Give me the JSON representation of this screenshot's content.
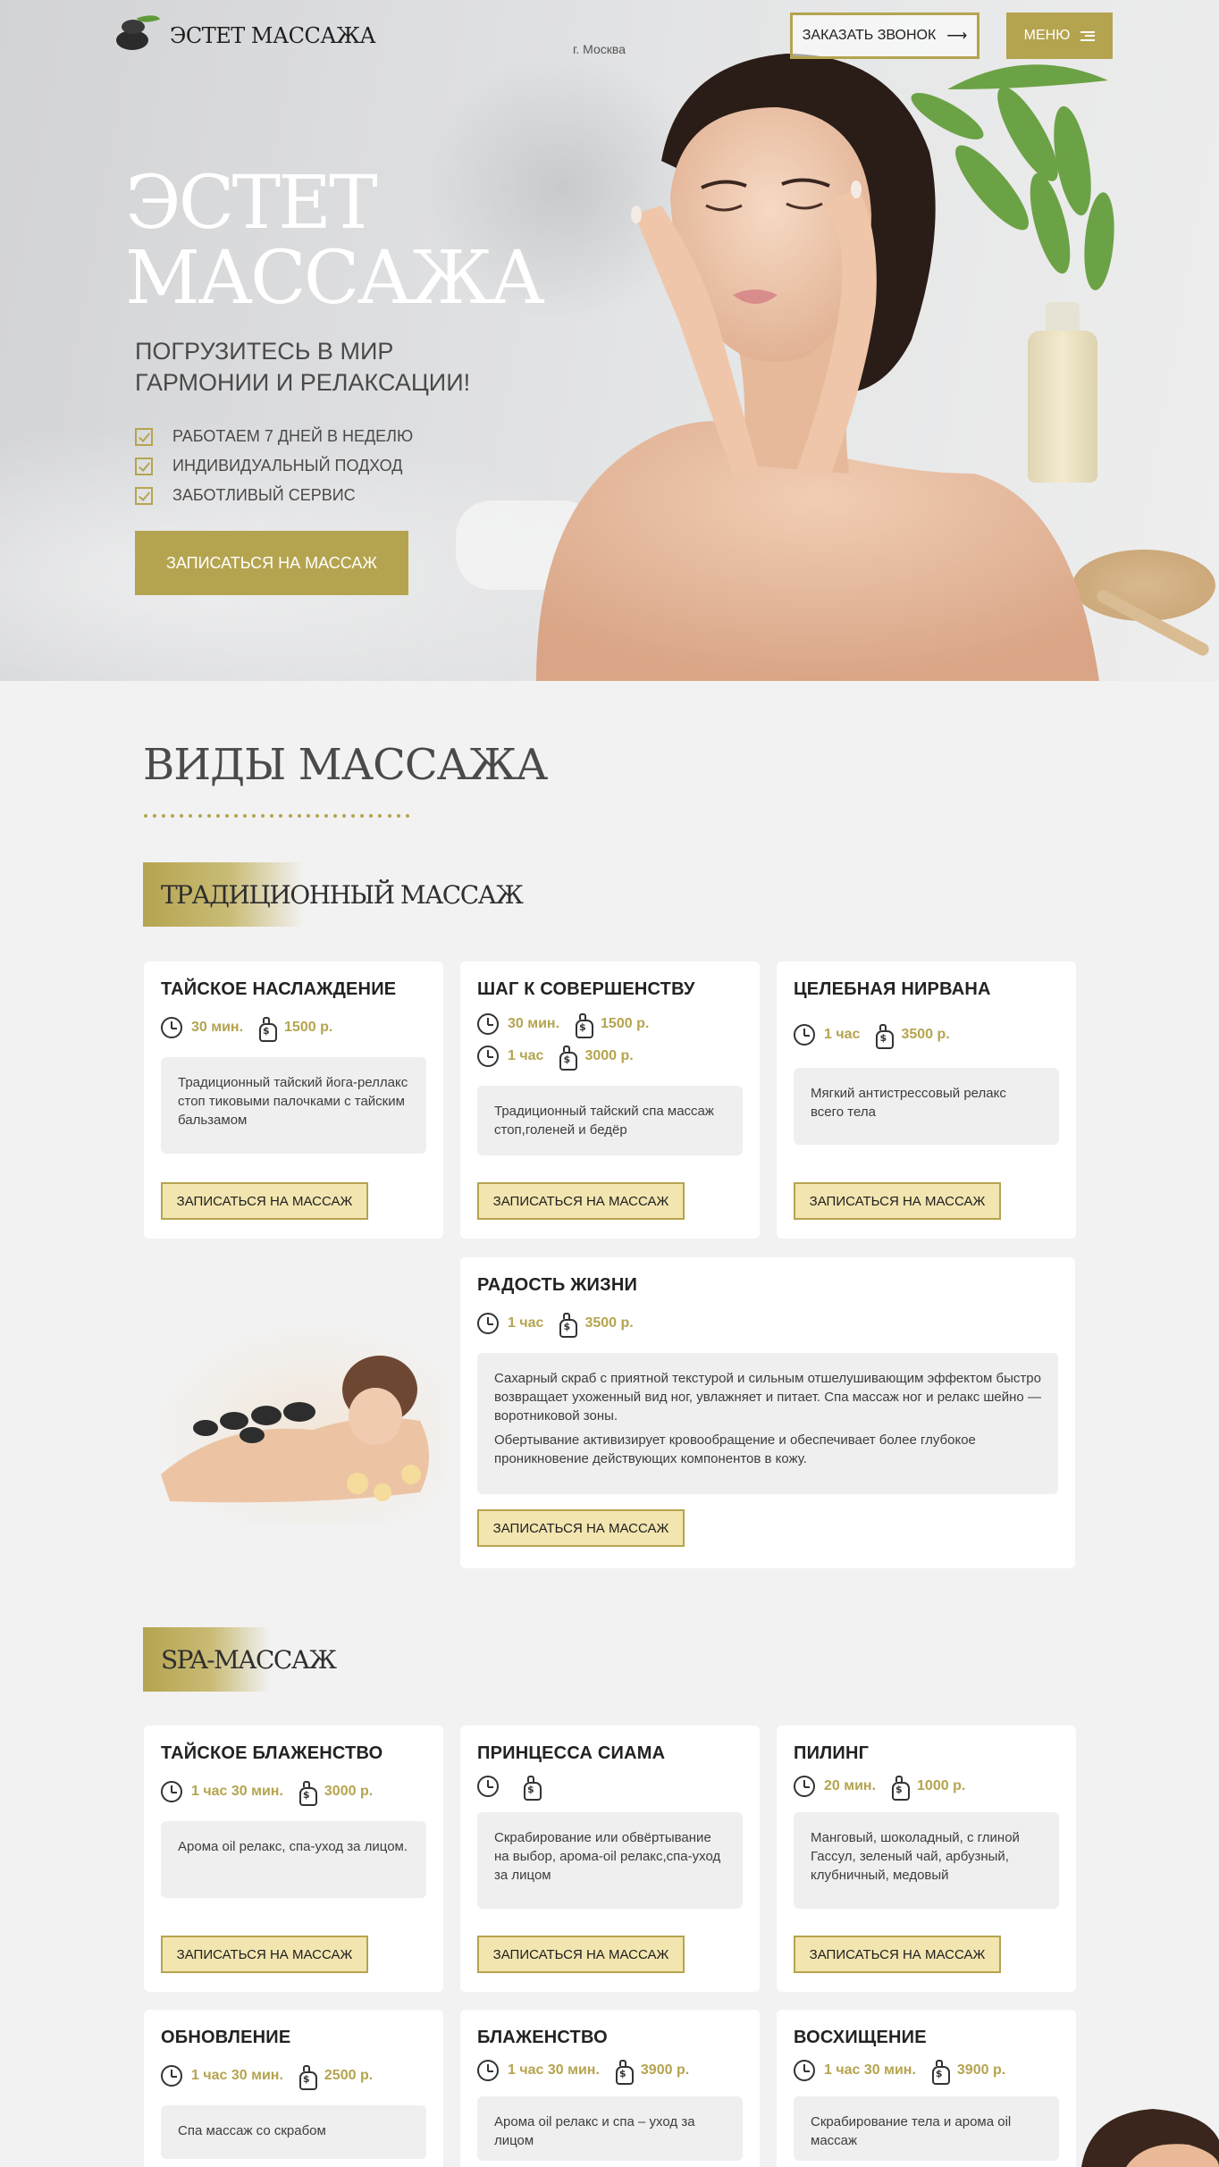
{
  "header": {
    "logo_text": "ЭСТЕТ МАССАЖА",
    "city": "г. Москва",
    "call_button": "ЗАКАЗАТЬ ЗВОНОК",
    "call_arrow": "⟶",
    "menu_button": "МЕНЮ"
  },
  "hero": {
    "title_line1": "ЭСТЕТ",
    "title_line2": "МАССАЖА",
    "subtitle_line1": "ПОГРУЗИТЕСЬ В МИР",
    "subtitle_line2": "ГАРМОНИИ И РЕЛАКСАЦИИ!",
    "features": [
      "РАБОТАЕМ 7 ДНЕЙ В НЕДЕЛЮ",
      "ИНДИВИДУАЛЬНЫЙ ПОДХОД",
      "ЗАБОТЛИВЫЙ СЕРВИС"
    ],
    "cta": "ЗАПИСАТЬСЯ НА МАССАЖ"
  },
  "section": {
    "title": "ВИДЫ МАССАЖА"
  },
  "traditional": {
    "label": "ТРАДИЦИОННЫЙ МАССАЖ",
    "cards": [
      {
        "title": "ТАЙСКОЕ НАСЛАЖДЕНИЕ",
        "time1": "30 мин.",
        "price1": "1500 р.",
        "desc": "Традиционный тайский йога-реллакс стоп тиковыми палочками с тайским бальзамом",
        "button": "ЗАПИСАТЬСЯ НА МАССАЖ"
      },
      {
        "title": "ШАГ К СОВЕРШЕНСТВУ",
        "time1": "30 мин.",
        "price1": "1500 р.",
        "time2": "1 час",
        "price2": "3000 р.",
        "desc": "Традиционный тайский спа массаж стоп,голеней и бедёр",
        "button": "ЗАПИСАТЬСЯ НА МАССАЖ"
      },
      {
        "title": "ЦЕЛЕБНАЯ НИРВАНА",
        "time1": "1 час",
        "price1": "3500 р.",
        "desc": "Мягкий антистрессовый релакс всего тела",
        "button": "ЗАПИСАТЬСЯ НА МАССАЖ"
      },
      {
        "title": "РАДОСТЬ ЖИЗНИ",
        "time1": "1 час",
        "price1": "3500 р.",
        "desc1": "Сахарный скраб с приятной текстурой и сильным отшелушивающим эффектом быстро возвращает ухоженный вид ног, увлажняет и питает. Спа массаж ног и релакс шейно — воротниковой зоны.",
        "desc2": "Обертывание активизирует кровообращение и обеспечивает более глубокое проникновение действующих компонентов в кожу.",
        "button": "ЗАПИСАТЬСЯ НА МАССАЖ"
      }
    ]
  },
  "spa": {
    "label": "SPA-МАССАЖ",
    "cards": [
      {
        "title": "ТАЙСКОЕ БЛАЖЕНСТВО",
        "time1": "1 час 30 мин.",
        "price1": "3000 р.",
        "desc": "Арома oil релакс, спа-уход за лицом.",
        "button": "ЗАПИСАТЬСЯ НА МАССАЖ"
      },
      {
        "title": "ПРИНЦЕССА СИАМА",
        "time1": "",
        "price1": "",
        "desc": "Скрабирование или обвёртывание на выбор, арома-oil релакс,спа-уход за лицом",
        "button": "ЗАПИСАТЬСЯ НА МАССАЖ"
      },
      {
        "title": "ПИЛИНГ",
        "time1": "20 мин.",
        "price1": "1000 р.",
        "desc": "Манговый, шоколадный, с глиной Гассул, зеленый чай, арбузный, клубничный, медовый",
        "button": "ЗАПИСАТЬСЯ НА МАССАЖ"
      },
      {
        "title": "ОБНОВЛЕНИЕ",
        "time1": "1 час 30 мин.",
        "price1": "2500 р.",
        "desc": "Спа массаж со скрабом"
      },
      {
        "title": "БЛАЖЕНСТВО",
        "time1": "1 час 30 мин.",
        "price1": "3900 р.",
        "desc": "Арома oil релакс и спа – уход за лицом"
      },
      {
        "title": "ВОСХИЩЕНИЕ",
        "time1": "1 час 30 мин.",
        "price1": "3900 р.",
        "desc": "Скрабирование тела и арома oil массаж"
      }
    ]
  },
  "colors": {
    "accent": "#b5a44f",
    "button_fill": "#f3e5b0",
    "page_bg": "#f2f2f2",
    "card_bg": "#ffffff",
    "desc_bg": "#efefef"
  },
  "icons": [
    "clock-icon",
    "money-bag-icon",
    "check-icon",
    "arrow-right-icon",
    "menu-icon"
  ]
}
